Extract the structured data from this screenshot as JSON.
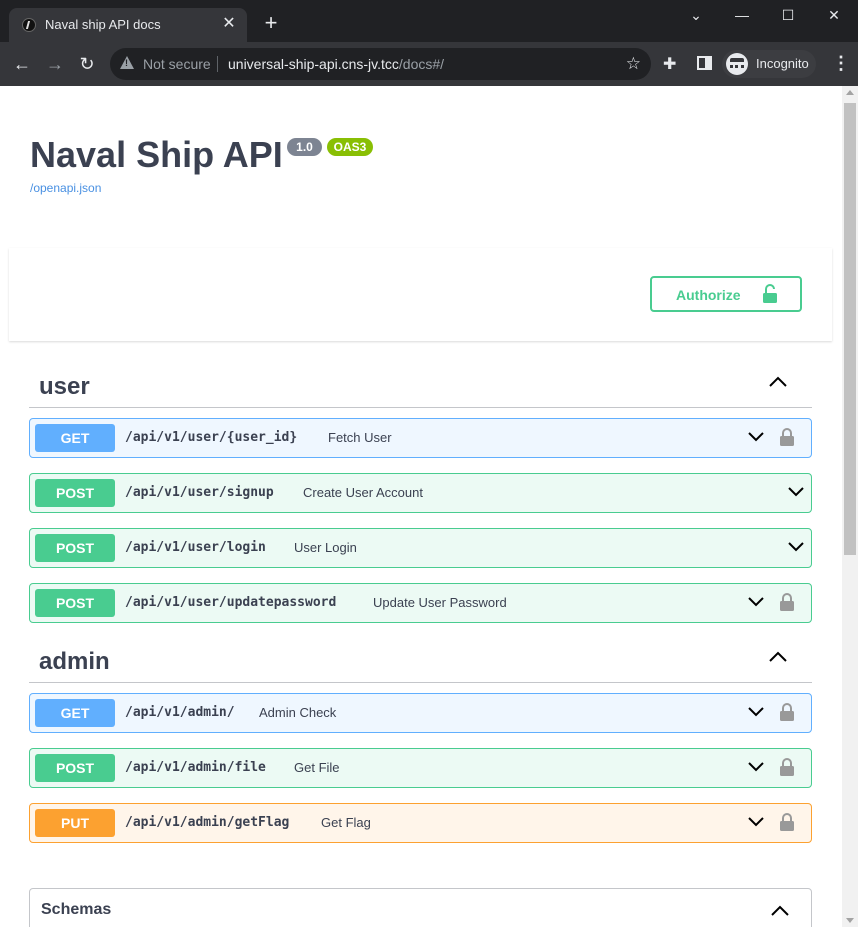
{
  "browser": {
    "tab_title": "Naval ship API docs",
    "tab_close": "✕",
    "new_tab": "+",
    "window_controls": {
      "minimize": "—",
      "maximize": "☐",
      "close": "✕",
      "tab_search": "⌄"
    },
    "security_label": "Not secure",
    "url_host": "universal-ship-api.cns-jv.tcc",
    "url_path": "/docs#/",
    "profile_label": "Incognito",
    "icons": [
      "back-icon",
      "forward-icon",
      "reload-icon",
      "warning-icon",
      "star-icon",
      "extensions-icon",
      "side-panel-icon",
      "incognito-icon",
      "menu-icon"
    ]
  },
  "info": {
    "title": "Naval Ship API",
    "version": "1.0",
    "oas": "OAS3",
    "spec_link": "/openapi.json"
  },
  "authorize": {
    "label": "Authorize"
  },
  "tags": [
    {
      "name": "user",
      "operations": [
        {
          "method": "GET",
          "path": "/api/v1/user/{user_id}",
          "summary": "Fetch User",
          "locked": true
        },
        {
          "method": "POST",
          "path": "/api/v1/user/signup",
          "summary": "Create User Account",
          "locked": false
        },
        {
          "method": "POST",
          "path": "/api/v1/user/login",
          "summary": "User Login",
          "locked": false
        },
        {
          "method": "POST",
          "path": "/api/v1/user/updatepassword",
          "summary": "Update User Password",
          "locked": true
        }
      ]
    },
    {
      "name": "admin",
      "operations": [
        {
          "method": "GET",
          "path": "/api/v1/admin/",
          "summary": "Admin Check",
          "locked": true
        },
        {
          "method": "POST",
          "path": "/api/v1/admin/file",
          "summary": "Get File",
          "locked": true
        },
        {
          "method": "PUT",
          "path": "/api/v1/admin/getFlag",
          "summary": "Get Flag",
          "locked": true
        }
      ]
    }
  ],
  "schemas": {
    "title": "Schemas"
  },
  "colors": {
    "get": "#61affe",
    "post": "#49cc90",
    "put": "#fca130",
    "text": "#3b4151",
    "link": "#4990e2",
    "oas_badge": "#89bf04",
    "version_badge": "#7d8492"
  }
}
